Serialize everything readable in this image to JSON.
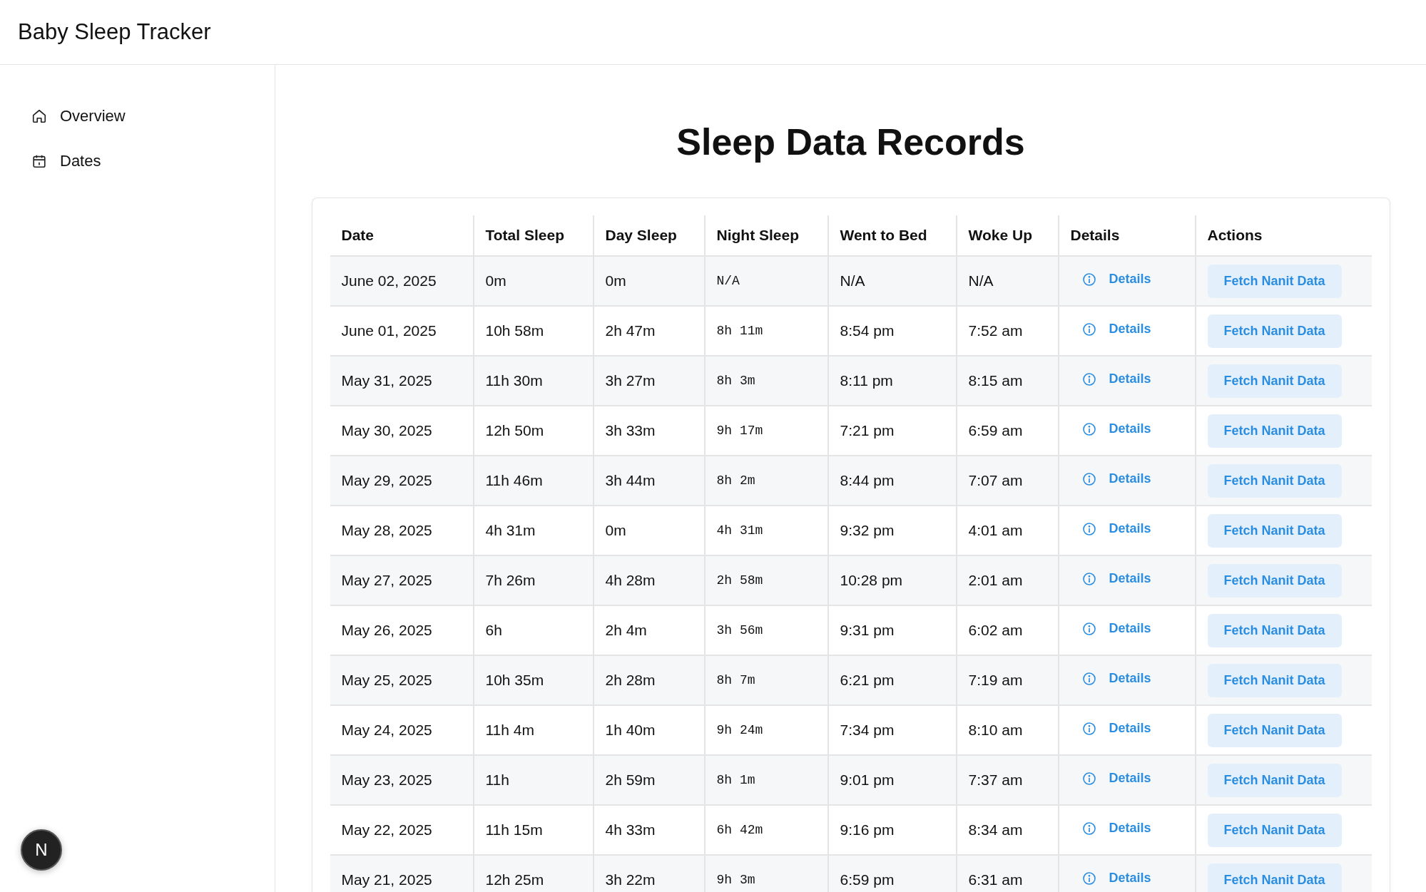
{
  "header": {
    "title": "Baby Sleep Tracker"
  },
  "sidebar": {
    "items": [
      {
        "kind": "home",
        "label": "Overview"
      },
      {
        "kind": "calendar",
        "label": "Dates"
      }
    ],
    "badge": "N"
  },
  "main": {
    "heading": "Sleep Data Records",
    "table": {
      "columns": [
        "Date",
        "Total Sleep",
        "Day Sleep",
        "Night Sleep",
        "Went to Bed",
        "Woke Up",
        "Details",
        "Actions"
      ],
      "rows": [
        {
          "date": "June 02, 2025",
          "total": "0m",
          "day": "0m",
          "night": "N/A",
          "bed": "N/A",
          "woke": "N/A",
          "details": "Details",
          "action": "Fetch Nanit Data"
        },
        {
          "date": "June 01, 2025",
          "total": "10h 58m",
          "day": "2h 47m",
          "night": "8h 11m",
          "bed": "8:54 pm",
          "woke": "7:52 am",
          "details": "Details",
          "action": "Fetch Nanit Data"
        },
        {
          "date": "May 31, 2025",
          "total": "11h 30m",
          "day": "3h 27m",
          "night": "8h 3m",
          "bed": "8:11 pm",
          "woke": "8:15 am",
          "details": "Details",
          "action": "Fetch Nanit Data"
        },
        {
          "date": "May 30, 2025",
          "total": "12h 50m",
          "day": "3h 33m",
          "night": "9h 17m",
          "bed": "7:21 pm",
          "woke": "6:59 am",
          "details": "Details",
          "action": "Fetch Nanit Data"
        },
        {
          "date": "May 29, 2025",
          "total": "11h 46m",
          "day": "3h 44m",
          "night": "8h 2m",
          "bed": "8:44 pm",
          "woke": "7:07 am",
          "details": "Details",
          "action": "Fetch Nanit Data"
        },
        {
          "date": "May 28, 2025",
          "total": "4h 31m",
          "day": "0m",
          "night": "4h 31m",
          "bed": "9:32 pm",
          "woke": "4:01 am",
          "details": "Details",
          "action": "Fetch Nanit Data"
        },
        {
          "date": "May 27, 2025",
          "total": "7h 26m",
          "day": "4h 28m",
          "night": "2h 58m",
          "bed": "10:28 pm",
          "woke": "2:01 am",
          "details": "Details",
          "action": "Fetch Nanit Data"
        },
        {
          "date": "May 26, 2025",
          "total": "6h",
          "day": "2h 4m",
          "night": "3h 56m",
          "bed": "9:31 pm",
          "woke": "6:02 am",
          "details": "Details",
          "action": "Fetch Nanit Data"
        },
        {
          "date": "May 25, 2025",
          "total": "10h 35m",
          "day": "2h 28m",
          "night": "8h 7m",
          "bed": "6:21 pm",
          "woke": "7:19 am",
          "details": "Details",
          "action": "Fetch Nanit Data"
        },
        {
          "date": "May 24, 2025",
          "total": "11h 4m",
          "day": "1h 40m",
          "night": "9h 24m",
          "bed": "7:34 pm",
          "woke": "8:10 am",
          "details": "Details",
          "action": "Fetch Nanit Data"
        },
        {
          "date": "May 23, 2025",
          "total": "11h",
          "day": "2h 59m",
          "night": "8h 1m",
          "bed": "9:01 pm",
          "woke": "7:37 am",
          "details": "Details",
          "action": "Fetch Nanit Data"
        },
        {
          "date": "May 22, 2025",
          "total": "11h 15m",
          "day": "4h 33m",
          "night": "6h 42m",
          "bed": "9:16 pm",
          "woke": "8:34 am",
          "details": "Details",
          "action": "Fetch Nanit Data"
        },
        {
          "date": "May 21, 2025",
          "total": "12h 25m",
          "day": "3h 22m",
          "night": "9h 3m",
          "bed": "6:59 pm",
          "woke": "6:31 am",
          "details": "Details",
          "action": "Fetch Nanit Data"
        }
      ]
    }
  }
}
